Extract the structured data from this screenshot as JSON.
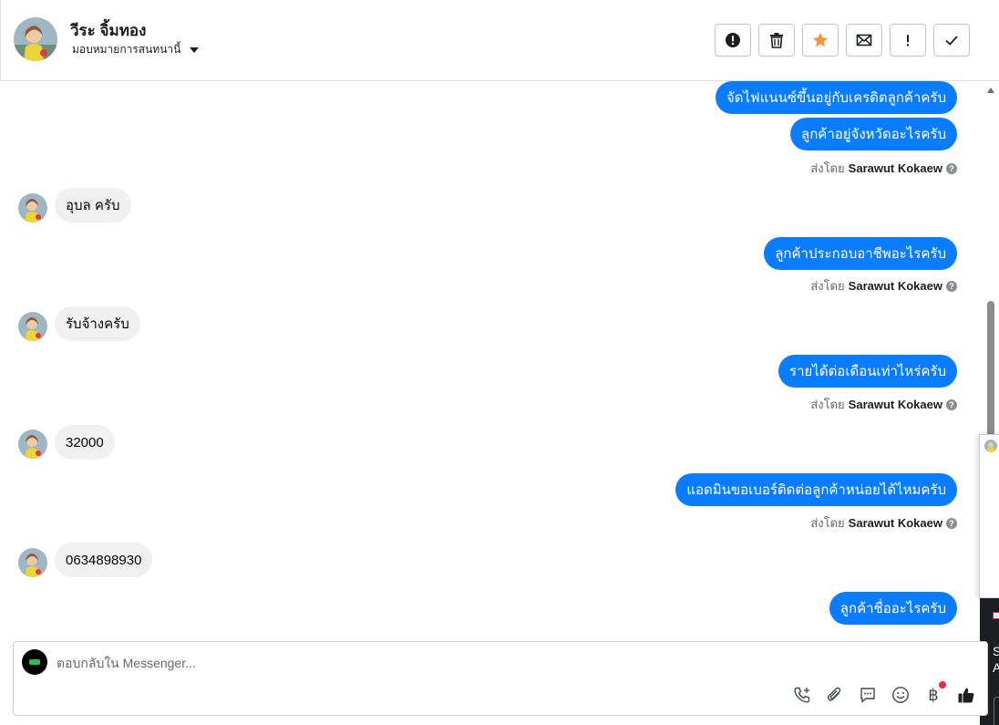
{
  "header": {
    "contact_name": "วีระ จิ้มทอง",
    "assign_label": "มอบหมายการสนทนานี้",
    "actions": [
      {
        "name": "spam-button",
        "icon": "alert-circle-icon"
      },
      {
        "name": "delete-button",
        "icon": "trash-icon"
      },
      {
        "name": "star-button",
        "icon": "star-icon"
      },
      {
        "name": "mark-unread-button",
        "icon": "envelope-icon"
      },
      {
        "name": "follow-up-button",
        "icon": "exclamation-icon"
      },
      {
        "name": "mark-done-button",
        "icon": "checkmark-icon"
      }
    ]
  },
  "thread": {
    "sent_by_prefix": "ส่งโดย",
    "sender_name": "Sarawut Kokaew",
    "help_glyph": "?",
    "messages": [
      {
        "direction": "out",
        "text": "จัดไฟแนนซ์ขึ้นอยู่กับเครดิตลูกค้าครับ"
      },
      {
        "direction": "out",
        "text": "ลูกค้าอยู่จังหวัดอะไรครับ"
      },
      {
        "direction": "in",
        "text": "อุบล ครับ"
      },
      {
        "direction": "out",
        "text": "ลูกค้าประกอบอาชีพอะไรครับ"
      },
      {
        "direction": "in",
        "text": "รับจ้างครับ"
      },
      {
        "direction": "out",
        "text": "รายได้ต่อเดือนเท่าไหร่ครับ"
      },
      {
        "direction": "in",
        "text": "32000"
      },
      {
        "direction": "out",
        "text": "แอดมินขอเบอร์ติดต่อลูกค้าหน่อยได้ไหมครับ"
      },
      {
        "direction": "in",
        "text": "0634898930"
      },
      {
        "direction": "out",
        "text": "ลูกค้าชื่ออะไรครับ"
      }
    ]
  },
  "composer": {
    "placeholder": "ตอบกลับใน Messenger...",
    "tools": [
      "phone-add-icon",
      "paperclip-icon",
      "saved-reply-icon",
      "emoji-icon",
      "baht-payment-icon",
      "thumbs-up-icon"
    ],
    "baht_glyph": "฿"
  },
  "edge": {
    "letter_1": "S",
    "letter_2": "A"
  },
  "colors": {
    "outgoing_bubble": "#0a7cff",
    "incoming_bubble": "#f0f0f0",
    "star": "#f7923b"
  }
}
